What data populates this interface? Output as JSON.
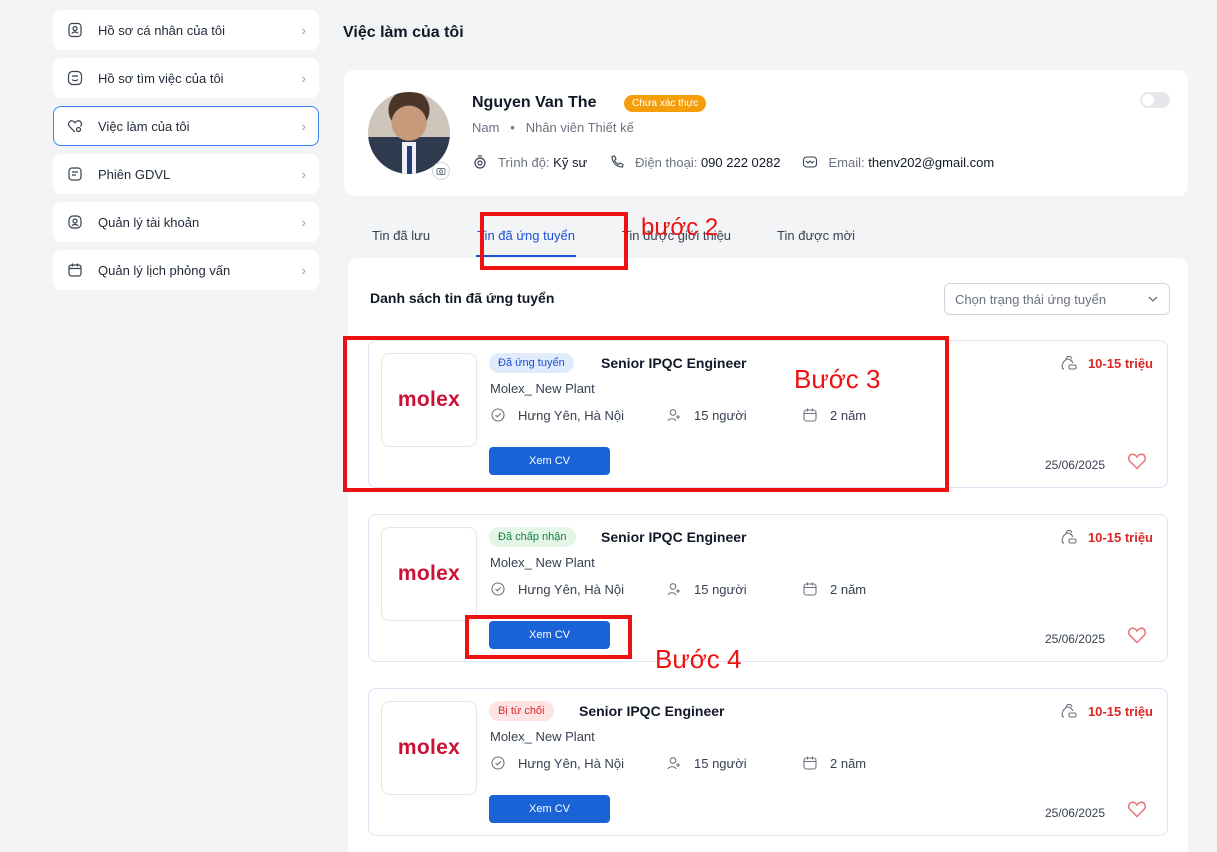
{
  "sidebar": {
    "items": [
      {
        "label": "Hồ sơ cá nhân của tôi",
        "icon": "profile-icon"
      },
      {
        "label": "Hồ sơ tìm việc của tôi",
        "icon": "resume-icon"
      },
      {
        "label": "Việc làm của tôi",
        "icon": "heart-search-icon"
      },
      {
        "label": "Phiên GDVL",
        "icon": "session-icon"
      },
      {
        "label": "Quản lý tài khoản",
        "icon": "account-icon"
      },
      {
        "label": "Quản lý lịch phỏng vấn",
        "icon": "calendar-icon"
      }
    ],
    "active_index": 2
  },
  "page_title": "Việc làm của tôi",
  "profile": {
    "name": "Nguyen Van The",
    "verify_badge": "Chưa xác thực",
    "gender": "Nam",
    "position": "Nhân viên Thiết kế",
    "education_label": "Trình độ:",
    "education_value": "Kỹ sư",
    "phone_label": "Điện thoại:",
    "phone_value": "090 222 0282",
    "email_label": "Email:",
    "email_value": "thenv202@gmail.com"
  },
  "tabs": [
    "Tin đã lưu",
    "Tin đã ứng tuyển",
    "Tin được giới thiệu",
    "Tin được mời"
  ],
  "active_tab": 1,
  "list": {
    "title": "Danh sách tin đã ứng tuyển",
    "filter_placeholder": "Chọn trạng thái ứng tuyển"
  },
  "jobs": [
    {
      "logo": "molex",
      "status": "Đã ứng tuyển",
      "status_color": "#e0ecfb",
      "status_text_color": "#1d4ed8",
      "title": "Senior IPQC Engineer",
      "company": "Molex_ New Plant",
      "location": "Hưng Yên, Hà Nội",
      "headcount": "15 người",
      "experience": "2 năm",
      "button": "Xem CV",
      "salary": "10-15 triệu",
      "date": "25/06/2025"
    },
    {
      "logo": "molex",
      "status": "Đã chấp nhận",
      "status_color": "#e3f6e8",
      "status_text_color": "#15803d",
      "title": "Senior IPQC Engineer",
      "company": "Molex_ New Plant",
      "location": "Hưng Yên, Hà Nội",
      "headcount": "15 người",
      "experience": "2 năm",
      "button": "Xem CV",
      "salary": "10-15 triệu",
      "date": "25/06/2025"
    },
    {
      "logo": "molex",
      "status": "Bị từ chối",
      "status_color": "#fde4e4",
      "status_text_color": "#dc2626",
      "title": "Senior IPQC Engineer",
      "company": "Molex_ New Plant",
      "location": "Hưng Yên, Hà Nội",
      "headcount": "15 người",
      "experience": "2 năm",
      "button": "Xem CV",
      "salary": "10-15 triệu",
      "date": "25/06/2025"
    }
  ],
  "annotations": {
    "step2": "bước 2",
    "step3": "Bước 3",
    "step4": "Bước 4",
    "color": "#ee1111"
  },
  "colors": {
    "accent": "#1a63d6",
    "salary": "#dc2626",
    "brand_logo": "#cc1137",
    "verify_badge": "#f59e0b"
  }
}
